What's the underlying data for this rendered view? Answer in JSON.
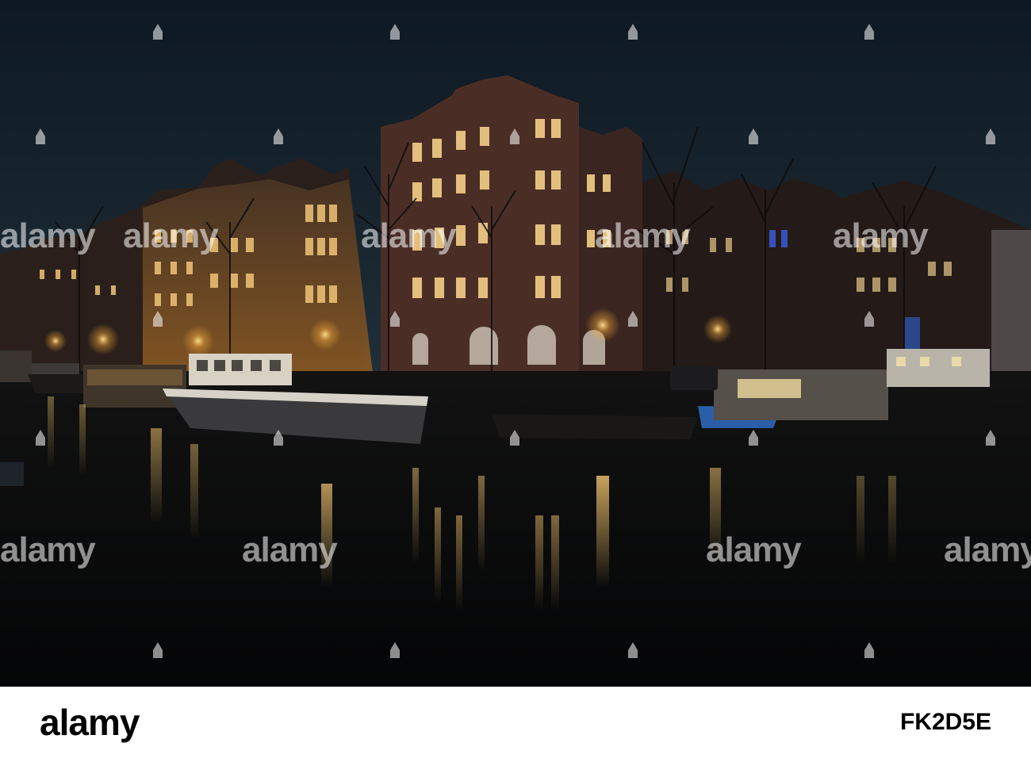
{
  "watermark": {
    "text": "alamy"
  },
  "footer": {
    "brand": "alamy",
    "image_id": "FK2D5E"
  },
  "colors": {
    "sky_top": "#0e1a25",
    "sky_bottom": "#1c2a33",
    "water": "#06080b",
    "lamp_glow": "#ffd27a",
    "brick": "#3a2822"
  }
}
